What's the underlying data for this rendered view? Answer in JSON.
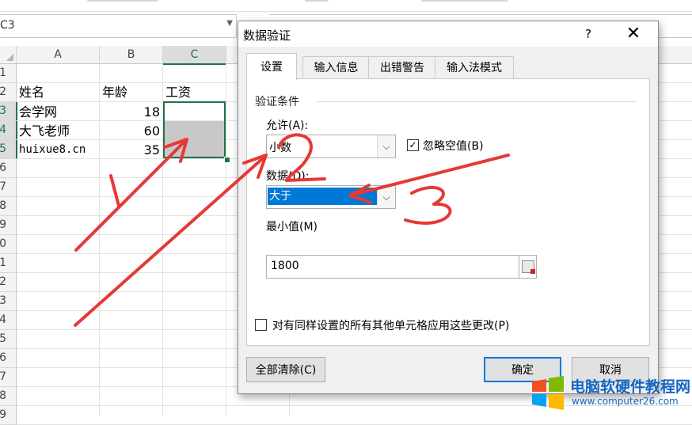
{
  "spreadsheet": {
    "name_box": "C3",
    "columns": [
      "A",
      "B",
      "C"
    ],
    "rows": [
      "1",
      "2",
      "3",
      "4",
      "5",
      "6",
      "7",
      "8",
      "9",
      "10",
      "11",
      "12",
      "13",
      "14",
      "15",
      "16",
      "17",
      "18",
      "19"
    ],
    "cells": {
      "a2": "姓名",
      "b2": "年龄",
      "c2": "工资",
      "a3": "会学网",
      "b3": "18",
      "a4": "大飞老师",
      "b4": "60",
      "a5": "huixue8.cn",
      "b5": "35"
    },
    "accent_color": "#217346"
  },
  "dialog": {
    "title": "数据验证",
    "help_label": "?",
    "close_label": "✕",
    "tabs": [
      {
        "label": "设置",
        "active": true
      },
      {
        "label": "输入信息",
        "active": false
      },
      {
        "label": "出错警告",
        "active": false
      },
      {
        "label": "输入法模式",
        "active": false
      }
    ],
    "section_title": "验证条件",
    "allow": {
      "label": "允许(A):",
      "value": "小数"
    },
    "ignore_blank": {
      "label": "忽略空值(B)",
      "checked": true
    },
    "data": {
      "label": "数据(D):",
      "value": "大于"
    },
    "minimum": {
      "label": "最小值(M)",
      "value": "1800"
    },
    "apply_all": {
      "label": "对有同样设置的所有其他单元格应用这些更改(P)",
      "checked": false
    },
    "clear_all_label": "全部清除(C)",
    "ok_label": "确定",
    "cancel_label": "取消"
  },
  "annotations": {
    "color": "#e53935",
    "marks": [
      "1",
      "2",
      "3"
    ]
  },
  "watermark": {
    "title": "电脑软硬件教程网",
    "url": "www.computer26.com"
  }
}
